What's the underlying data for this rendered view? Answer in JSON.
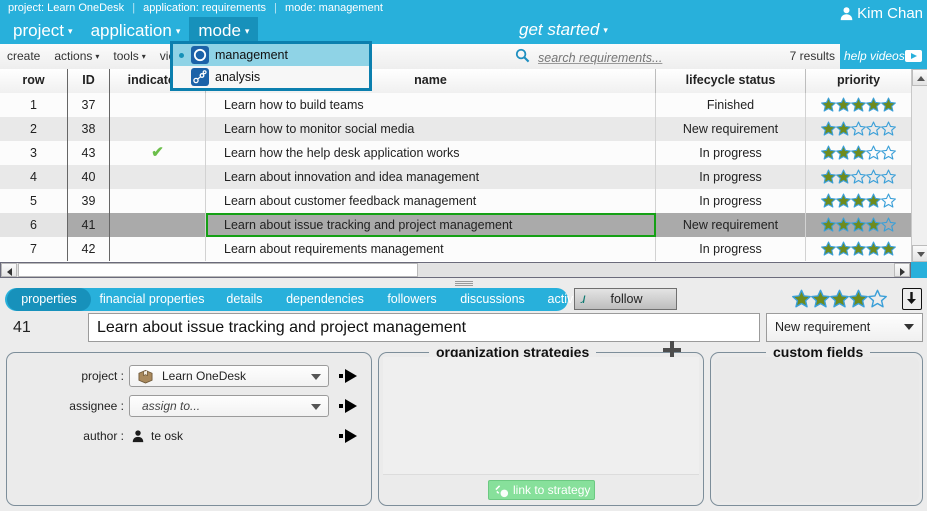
{
  "breadcrumb": {
    "project": "project: Learn OneDesk",
    "application": "application: requirements",
    "mode": "mode: management"
  },
  "menubar": {
    "items": [
      {
        "label": "project",
        "caret": "▾",
        "active": false
      },
      {
        "label": "application",
        "caret": "▾",
        "active": false
      },
      {
        "label": "mode",
        "caret": "▾",
        "active": true
      }
    ],
    "get_started": "get started",
    "get_started_caret": "▾"
  },
  "user": {
    "name": "Kim Chan"
  },
  "toolbar": {
    "items": [
      {
        "label": "create",
        "caret": ""
      },
      {
        "label": "actions",
        "caret": "▾"
      },
      {
        "label": "tools",
        "caret": "▾"
      },
      {
        "label": "views",
        "caret": "▾"
      }
    ]
  },
  "search": {
    "placeholder": "search requirements...",
    "value": "",
    "results": "7 results"
  },
  "help_videos": {
    "label": "help videos"
  },
  "mode_menu": {
    "items": [
      {
        "label": "management",
        "selected": true
      },
      {
        "label": "analysis",
        "selected": false
      }
    ]
  },
  "grid": {
    "columns": [
      {
        "key": "row",
        "label": "row"
      },
      {
        "key": "id",
        "label": "ID"
      },
      {
        "key": "indicators",
        "label": "indicators"
      },
      {
        "key": "name",
        "label": "name"
      },
      {
        "key": "lifecycle",
        "label": "lifecycle status"
      },
      {
        "key": "priority",
        "label": "priority"
      }
    ],
    "rows": [
      {
        "row": "1",
        "id": "37",
        "indicator": "",
        "name": "Learn how to build teams",
        "lifecycle": "Finished",
        "priority": 5,
        "selected": false
      },
      {
        "row": "2",
        "id": "38",
        "indicator": "",
        "name": "Learn how to monitor social media",
        "lifecycle": "New requirement",
        "priority": 2,
        "selected": false
      },
      {
        "row": "3",
        "id": "43",
        "indicator": "✔",
        "name": "Learn how the help desk application works",
        "lifecycle": "In progress",
        "priority": 3,
        "selected": false
      },
      {
        "row": "4",
        "id": "40",
        "indicator": "",
        "name": "Learn about innovation and idea management",
        "lifecycle": "In progress",
        "priority": 2,
        "selected": false
      },
      {
        "row": "5",
        "id": "39",
        "indicator": "",
        "name": "Learn about customer feedback management",
        "lifecycle": "In progress",
        "priority": 4,
        "selected": false
      },
      {
        "row": "6",
        "id": "41",
        "indicator": "",
        "name": "Learn about issue tracking and project management",
        "lifecycle": "New requirement",
        "priority": 4,
        "selected": true
      },
      {
        "row": "7",
        "id": "42",
        "indicator": "",
        "name": "Learn about requirements management",
        "lifecycle": "In progress",
        "priority": 5,
        "selected": false
      }
    ],
    "priority_max": 5
  },
  "tabs": {
    "items": [
      {
        "label": "properties",
        "active": true
      },
      {
        "label": "financial properties",
        "active": false
      },
      {
        "label": "details",
        "active": false
      },
      {
        "label": "dependencies",
        "active": false
      },
      {
        "label": "followers",
        "active": false
      },
      {
        "label": "discussions",
        "active": false
      },
      {
        "label": "activities",
        "active": false
      }
    ],
    "follow_label": "follow",
    "rating": 4,
    "rating_max": 5
  },
  "detail": {
    "id": "41",
    "title": "Learn about issue tracking and project management",
    "title_placeholder": "",
    "status": "New requirement"
  },
  "properties_panel": {
    "fields": [
      {
        "label": "project :",
        "value": "Learn OneDesk",
        "placeholder": false
      },
      {
        "label": "assignee :",
        "value": "assign to...",
        "placeholder": true
      },
      {
        "label": "author :",
        "value": "te osk",
        "placeholder": false
      }
    ]
  },
  "organization_strategies": {
    "title": "organization strategies",
    "link_button": "link to strategy"
  },
  "custom_fields": {
    "title": "custom fields"
  },
  "colors": {
    "brand_blue": "#28b0db",
    "brand_blue_dark": "#1791bb",
    "menu_border": "#0b7fae",
    "selection_green": "#15a015",
    "star_fill": "#6e8b1e",
    "star_outline": "#3a9fd8",
    "link_green": "#87e09b",
    "check_green": "#6cbf4b"
  }
}
